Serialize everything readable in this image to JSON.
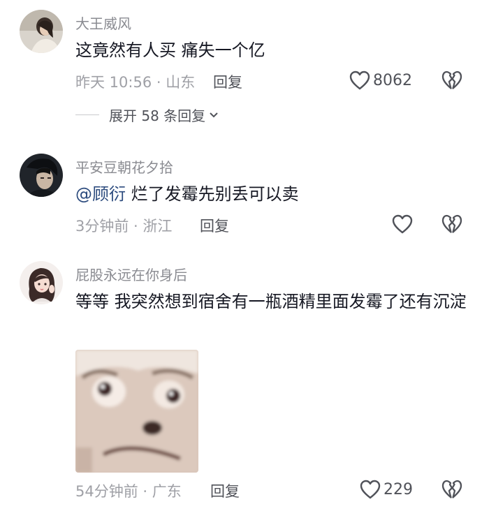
{
  "comments": [
    {
      "username": "大王威风",
      "text": "这竟然有人买 痛失一个亿",
      "time_location": "昨天 10:56 · 山东",
      "reply_label": "回复",
      "like_count": "8062",
      "expand_label": "展开 58 条回复"
    },
    {
      "username": "平安豆朝花夕拾",
      "mention": "@顾衍",
      "text": " 烂了发霉先别丢可以卖",
      "time_location": "3分钟前 · 浙江",
      "reply_label": "回复"
    },
    {
      "username": "屁股永远在你身后",
      "text": "等等 我突然想到宿舍有一瓶酒精里面发霉了还有沉淀",
      "time_location": "54分钟前 · 广东",
      "reply_label": "回复",
      "like_count": "229"
    }
  ],
  "icons": {
    "like": "heart-outline-icon",
    "dislike": "broken-heart-icon",
    "expand": "chevron-down-icon"
  }
}
